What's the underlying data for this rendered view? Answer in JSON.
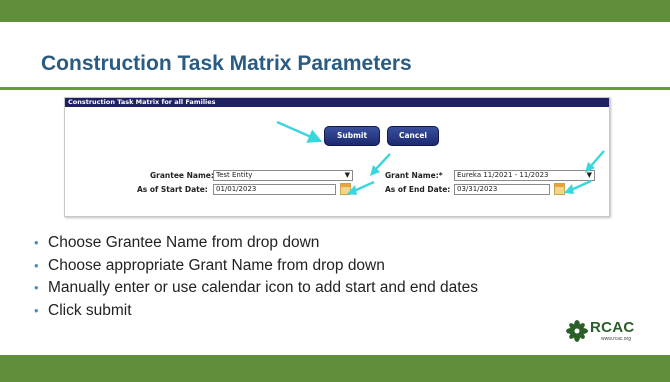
{
  "slide": {
    "title": "Construction Task Matrix Parameters",
    "bullets": [
      "Choose Grantee Name from drop down",
      "Choose appropriate Grant Name from drop down",
      "Manually enter or use calendar icon to add start and end dates",
      "Click submit"
    ]
  },
  "form": {
    "header": "Construction Task Matrix for all Families",
    "submit_label": "Submit",
    "cancel_label": "Cancel",
    "grantee_label": "Grantee Name:",
    "grantee_value": "Test Entity",
    "grant_label": "Grant Name:*",
    "grant_value": "Eureka 11/2021 - 11/2023",
    "start_label": "As of Start Date:",
    "start_value": "01/01/2023",
    "end_label": "As of End Date:",
    "end_value": "03/31/2023"
  },
  "logo": {
    "name": "RCAC",
    "url": "www.rcac.org",
    "icon": "leaf-icon"
  },
  "colors": {
    "band_green": "#5f8f3b",
    "title_blue": "#2a5c83",
    "header_navy": "#1f1f66",
    "arrow_cyan": "#3ad6dc"
  }
}
